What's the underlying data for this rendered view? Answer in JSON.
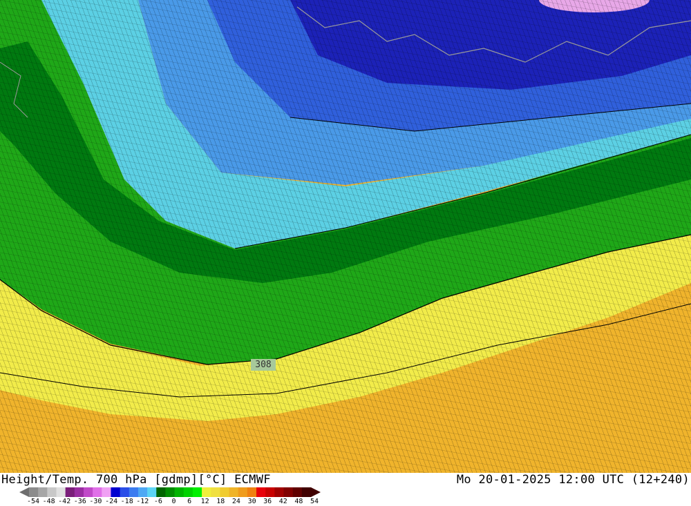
{
  "header": {
    "title": "Height/Temp. 700 hPa [gdmp][°C] ECMWF",
    "valid_time": "Mo 20-01-2025 12:00 UTC (12+240)"
  },
  "map": {
    "contour_label": "308"
  },
  "legend": {
    "ticks": [
      "-54",
      "-48",
      "-42",
      "-36",
      "-30",
      "-24",
      "-18",
      "-12",
      "-6",
      "0",
      "6",
      "12",
      "18",
      "24",
      "30",
      "36",
      "42",
      "48",
      "54"
    ],
    "colors": [
      "#8c8c8c",
      "#a6a6a6",
      "#c8c8c8",
      "#e0e0e0",
      "#7a1e7a",
      "#9a2ea2",
      "#c04ac8",
      "#e070e8",
      "#f0a0f4",
      "#0000d0",
      "#2a4ee8",
      "#3c7cf0",
      "#4ea8f4",
      "#5cd4f4",
      "#006400",
      "#008c00",
      "#00b400",
      "#00d200",
      "#00f000",
      "#f0f03c",
      "#f0e040",
      "#f0cc30",
      "#f0b428",
      "#f09c1c",
      "#f08010",
      "#e8000a",
      "#c80000",
      "#a00000",
      "#800000",
      "#600000",
      "#400000"
    ]
  }
}
